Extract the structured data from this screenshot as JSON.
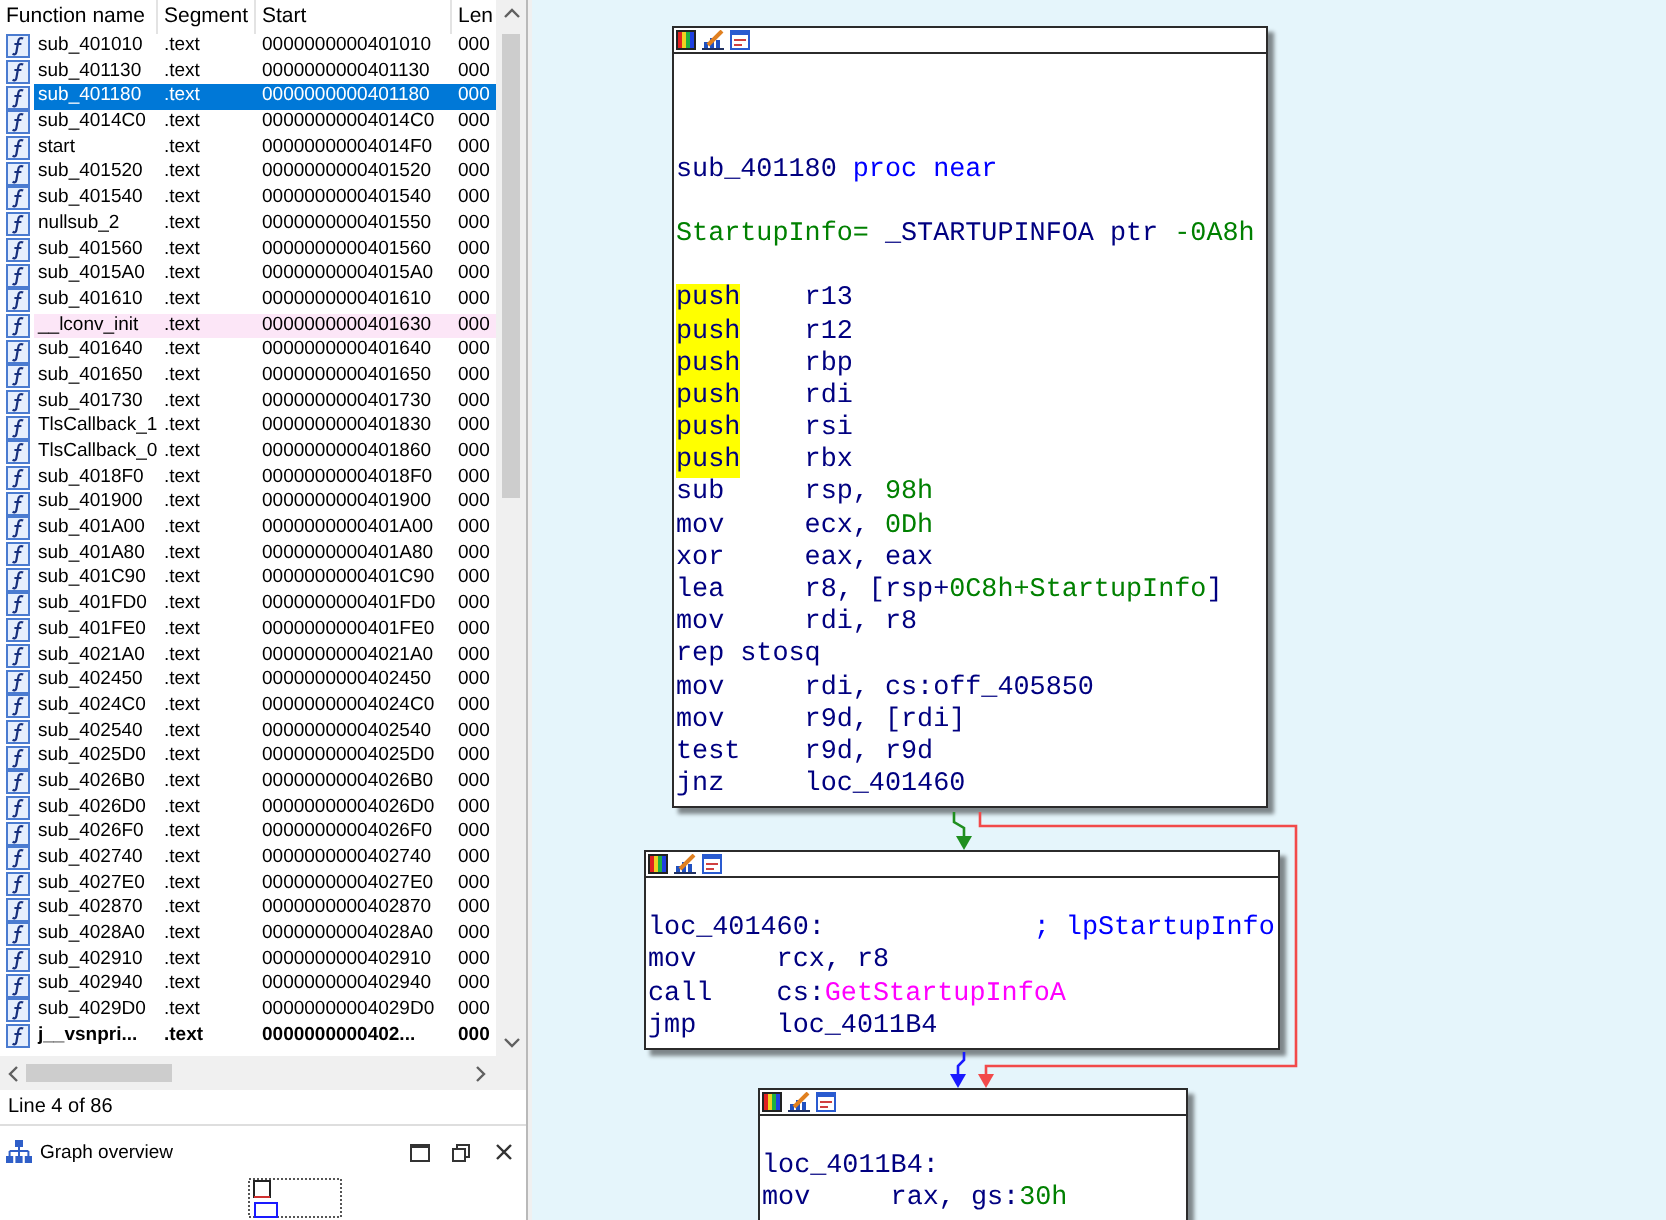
{
  "function_list": {
    "columns": [
      "Function name",
      "Segment",
      "Start",
      "Len"
    ],
    "rows": [
      {
        "name": "sub_401010",
        "segment": ".text",
        "start": "0000000000401010",
        "length": "000",
        "kind": "function",
        "selected": false
      },
      {
        "name": "sub_401130",
        "segment": ".text",
        "start": "0000000000401130",
        "length": "000",
        "kind": "function",
        "selected": false
      },
      {
        "name": "sub_401180",
        "segment": ".text",
        "start": "0000000000401180",
        "length": "000",
        "kind": "function",
        "selected": true
      },
      {
        "name": "sub_4014C0",
        "segment": ".text",
        "start": "00000000004014C0",
        "length": "000",
        "kind": "function",
        "selected": false
      },
      {
        "name": "start",
        "segment": ".text",
        "start": "00000000004014F0",
        "length": "000",
        "kind": "function",
        "selected": false
      },
      {
        "name": "sub_401520",
        "segment": ".text",
        "start": "0000000000401520",
        "length": "000",
        "kind": "function",
        "selected": false
      },
      {
        "name": "sub_401540",
        "segment": ".text",
        "start": "0000000000401540",
        "length": "000",
        "kind": "function",
        "selected": false
      },
      {
        "name": "nullsub_2",
        "segment": ".text",
        "start": "0000000000401550",
        "length": "000",
        "kind": "function",
        "selected": false
      },
      {
        "name": "sub_401560",
        "segment": ".text",
        "start": "0000000000401560",
        "length": "000",
        "kind": "function",
        "selected": false
      },
      {
        "name": "sub_4015A0",
        "segment": ".text",
        "start": "00000000004015A0",
        "length": "000",
        "kind": "function",
        "selected": false
      },
      {
        "name": "sub_401610",
        "segment": ".text",
        "start": "0000000000401610",
        "length": "000",
        "kind": "function",
        "selected": false
      },
      {
        "name": "__lconv_init",
        "segment": ".text",
        "start": "0000000000401630",
        "length": "000",
        "kind": "library",
        "selected": false
      },
      {
        "name": "sub_401640",
        "segment": ".text",
        "start": "0000000000401640",
        "length": "000",
        "kind": "function",
        "selected": false
      },
      {
        "name": "sub_401650",
        "segment": ".text",
        "start": "0000000000401650",
        "length": "000",
        "kind": "function",
        "selected": false
      },
      {
        "name": "sub_401730",
        "segment": ".text",
        "start": "0000000000401730",
        "length": "000",
        "kind": "function",
        "selected": false
      },
      {
        "name": "TlsCallback_1",
        "segment": ".text",
        "start": "0000000000401830",
        "length": "000",
        "kind": "function",
        "selected": false
      },
      {
        "name": "TlsCallback_0",
        "segment": ".text",
        "start": "0000000000401860",
        "length": "000",
        "kind": "function",
        "selected": false
      },
      {
        "name": "sub_4018F0",
        "segment": ".text",
        "start": "00000000004018F0",
        "length": "000",
        "kind": "function",
        "selected": false
      },
      {
        "name": "sub_401900",
        "segment": ".text",
        "start": "0000000000401900",
        "length": "000",
        "kind": "function",
        "selected": false
      },
      {
        "name": "sub_401A00",
        "segment": ".text",
        "start": "0000000000401A00",
        "length": "000",
        "kind": "function",
        "selected": false
      },
      {
        "name": "sub_401A80",
        "segment": ".text",
        "start": "0000000000401A80",
        "length": "000",
        "kind": "function",
        "selected": false
      },
      {
        "name": "sub_401C90",
        "segment": ".text",
        "start": "0000000000401C90",
        "length": "000",
        "kind": "function",
        "selected": false
      },
      {
        "name": "sub_401FD0",
        "segment": ".text",
        "start": "0000000000401FD0",
        "length": "000",
        "kind": "function",
        "selected": false
      },
      {
        "name": "sub_401FE0",
        "segment": ".text",
        "start": "0000000000401FE0",
        "length": "000",
        "kind": "function",
        "selected": false
      },
      {
        "name": "sub_4021A0",
        "segment": ".text",
        "start": "00000000004021A0",
        "length": "000",
        "kind": "function",
        "selected": false
      },
      {
        "name": "sub_402450",
        "segment": ".text",
        "start": "0000000000402450",
        "length": "000",
        "kind": "function",
        "selected": false
      },
      {
        "name": "sub_4024C0",
        "segment": ".text",
        "start": "00000000004024C0",
        "length": "000",
        "kind": "function",
        "selected": false
      },
      {
        "name": "sub_402540",
        "segment": ".text",
        "start": "0000000000402540",
        "length": "000",
        "kind": "function",
        "selected": false
      },
      {
        "name": "sub_4025D0",
        "segment": ".text",
        "start": "00000000004025D0",
        "length": "000",
        "kind": "function",
        "selected": false
      },
      {
        "name": "sub_4026B0",
        "segment": ".text",
        "start": "00000000004026B0",
        "length": "000",
        "kind": "function",
        "selected": false
      },
      {
        "name": "sub_4026D0",
        "segment": ".text",
        "start": "00000000004026D0",
        "length": "000",
        "kind": "function",
        "selected": false
      },
      {
        "name": "sub_4026F0",
        "segment": ".text",
        "start": "00000000004026F0",
        "length": "000",
        "kind": "function",
        "selected": false
      },
      {
        "name": "sub_402740",
        "segment": ".text",
        "start": "0000000000402740",
        "length": "000",
        "kind": "function",
        "selected": false
      },
      {
        "name": "sub_4027E0",
        "segment": ".text",
        "start": "00000000004027E0",
        "length": "000",
        "kind": "function",
        "selected": false
      },
      {
        "name": "sub_402870",
        "segment": ".text",
        "start": "0000000000402870",
        "length": "000",
        "kind": "function",
        "selected": false
      },
      {
        "name": "sub_4028A0",
        "segment": ".text",
        "start": "00000000004028A0",
        "length": "000",
        "kind": "function",
        "selected": false
      },
      {
        "name": "sub_402910",
        "segment": ".text",
        "start": "0000000000402910",
        "length": "000",
        "kind": "function",
        "selected": false
      },
      {
        "name": "sub_402940",
        "segment": ".text",
        "start": "0000000000402940",
        "length": "000",
        "kind": "function",
        "selected": false
      },
      {
        "name": "sub_4029D0",
        "segment": ".text",
        "start": "00000000004029D0",
        "length": "000",
        "kind": "function",
        "selected": false
      },
      {
        "name": "j__vsnpri...",
        "segment": ".text",
        "start": "0000000000402...",
        "length": "000",
        "kind": "thunk",
        "selected": false
      }
    ],
    "status": "Line 4 of 86"
  },
  "graph_overview": {
    "title": "Graph overview"
  },
  "graph": {
    "blocks": [
      {
        "lines": [
          {
            "kind": "proc",
            "parts": [
              {
                "text": "sub_401180",
                "kind": "name"
              },
              {
                "text": " proc near",
                "kind": "keyword"
              }
            ]
          },
          {
            "kind": "stack_var",
            "parts": [
              {
                "text": "StartupInfo=",
                "kind": "var"
              },
              {
                "text": " _STARTUPINFOA ptr ",
                "kind": "plain"
              },
              {
                "text": "-0A8h",
                "kind": "number"
              }
            ]
          },
          {
            "kind": "instr",
            "mnemonic": "push",
            "highlighted": true,
            "operands": [
              {
                "text": "r13",
                "kind": "plain"
              }
            ]
          },
          {
            "kind": "instr",
            "mnemonic": "push",
            "highlighted": true,
            "operands": [
              {
                "text": "r12",
                "kind": "plain"
              }
            ]
          },
          {
            "kind": "instr",
            "mnemonic": "push",
            "highlighted": true,
            "operands": [
              {
                "text": "rbp",
                "kind": "plain"
              }
            ]
          },
          {
            "kind": "instr",
            "mnemonic": "push",
            "highlighted": true,
            "operands": [
              {
                "text": "rdi",
                "kind": "plain"
              }
            ]
          },
          {
            "kind": "instr",
            "mnemonic": "push",
            "highlighted": true,
            "operands": [
              {
                "text": "rsi",
                "kind": "plain"
              }
            ]
          },
          {
            "kind": "instr",
            "mnemonic": "push",
            "highlighted": true,
            "operands": [
              {
                "text": "rbx",
                "kind": "plain"
              }
            ]
          },
          {
            "kind": "instr",
            "mnemonic": "sub",
            "highlighted": false,
            "operands": [
              {
                "text": "rsp, ",
                "kind": "plain"
              },
              {
                "text": "98h",
                "kind": "number"
              }
            ]
          },
          {
            "kind": "instr",
            "mnemonic": "mov",
            "highlighted": false,
            "operands": [
              {
                "text": "ecx, ",
                "kind": "plain"
              },
              {
                "text": "0Dh",
                "kind": "number"
              }
            ]
          },
          {
            "kind": "instr",
            "mnemonic": "xor",
            "highlighted": false,
            "operands": [
              {
                "text": "eax, eax",
                "kind": "plain"
              }
            ]
          },
          {
            "kind": "instr",
            "mnemonic": "lea",
            "highlighted": false,
            "operands": [
              {
                "text": "r8, [rsp+",
                "kind": "plain"
              },
              {
                "text": "0C8h+StartupInfo",
                "kind": "var"
              },
              {
                "text": "]",
                "kind": "plain"
              }
            ]
          },
          {
            "kind": "instr",
            "mnemonic": "mov",
            "highlighted": false,
            "operands": [
              {
                "text": "rdi, r8",
                "kind": "plain"
              }
            ]
          },
          {
            "kind": "instr",
            "mnemonic": "rep stosq",
            "highlighted": false
          },
          {
            "kind": "instr",
            "mnemonic": "mov",
            "highlighted": false,
            "operands": [
              {
                "text": "rdi, cs:off_405850",
                "kind": "plain"
              }
            ]
          },
          {
            "kind": "instr",
            "mnemonic": "mov",
            "highlighted": false,
            "operands": [
              {
                "text": "r9d, [rdi]",
                "kind": "plain"
              }
            ]
          },
          {
            "kind": "instr",
            "mnemonic": "test",
            "highlighted": false,
            "operands": [
              {
                "text": "r9d, r9d",
                "kind": "plain"
              }
            ]
          },
          {
            "kind": "instr",
            "mnemonic": "jnz",
            "highlighted": false,
            "operands": [
              {
                "text": "loc_401460",
                "kind": "plain"
              }
            ]
          }
        ]
      },
      {
        "lines": [
          {
            "kind": "label",
            "label": "loc_401460:",
            "comment": "; lpStartupInfo"
          },
          {
            "kind": "instr",
            "mnemonic": "mov",
            "highlighted": false,
            "operands": [
              {
                "text": "rcx, r8",
                "kind": "plain"
              }
            ]
          },
          {
            "kind": "instr",
            "mnemonic": "call",
            "highlighted": false,
            "operands": [
              {
                "text": "cs:",
                "kind": "plain"
              },
              {
                "text": "GetStartupInfoA",
                "kind": "import"
              }
            ]
          },
          {
            "kind": "instr",
            "mnemonic": "jmp",
            "highlighted": false,
            "operands": [
              {
                "text": "loc_4011B4",
                "kind": "plain"
              }
            ]
          }
        ]
      },
      {
        "lines": [
          {
            "kind": "label",
            "label": "loc_4011B4:"
          },
          {
            "kind": "instr",
            "mnemonic": "mov",
            "highlighted": false,
            "operands": [
              {
                "text": "rax, gs:",
                "kind": "plain"
              },
              {
                "text": "30h",
                "kind": "number"
              }
            ]
          }
        ]
      }
    ],
    "edges": [
      {
        "kind": "taken"
      },
      {
        "kind": "fallthrough"
      },
      {
        "kind": "jump"
      }
    ]
  }
}
